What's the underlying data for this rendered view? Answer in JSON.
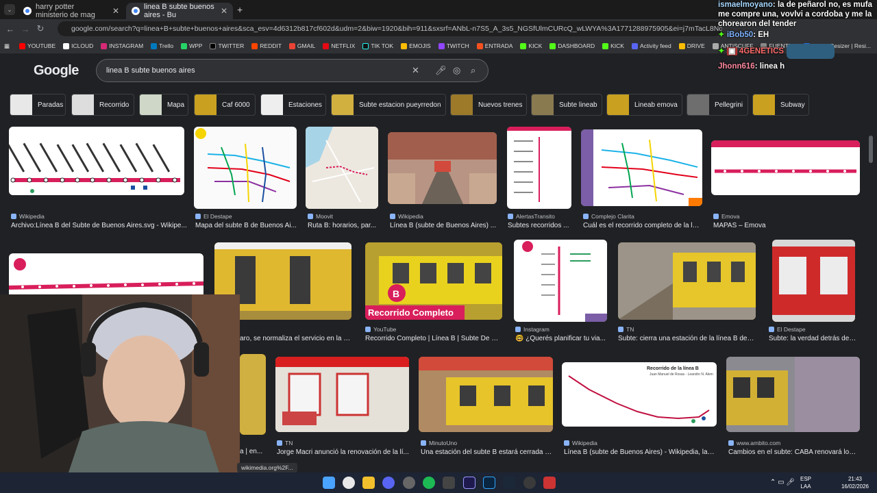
{
  "tabs": [
    {
      "title": "harry potter ministerio de mag"
    },
    {
      "title": "linea B subte buenos aires - Bu"
    }
  ],
  "url": "google.com/search?q=linea+B+subte+buenos+aires&sca_esv=4d6312b817cf602d&udm=2&biw=1920&bih=911&sxsrf=ANbL-n7S5_A_3s5_NGSfUlmCURcQ_wLWYA%3A1771288975905&ei=j7mTacL8NqeZ1sQP49TBgQ8&ved=0ah",
  "bookmarks": [
    "YOUTUBE",
    "ICLOUD",
    "INSTAGRAM",
    "Trello",
    "WPP",
    "TWITTER",
    "REDDIT",
    "GMAIL",
    "NETFLIX",
    "TIK TOK",
    "EMOJIS",
    "TWITCH",
    "ENTRADA",
    "KICK",
    "DASHBOARD",
    "KICK",
    "Activity feed",
    "DRIVE",
    "ANTISCUFF",
    "FUENTES",
    "Image Resizer | Resi..."
  ],
  "logo": "Google",
  "query": "linea B subte buenos aires",
  "chips": [
    "Paradas",
    "Recorrido",
    "Mapa",
    "Caf 6000",
    "Estaciones",
    "Subte estacion pueyrredon",
    "Nuevos trenes",
    "Subte lineab",
    "Lineab emova",
    "Pellegrini",
    "Subway"
  ],
  "row1": [
    {
      "src": "Wikipedia",
      "cap": "Archivo:Línea B del Subte de Buenos Aires.svg - Wikipe..."
    },
    {
      "src": "El Destape",
      "cap": "Mapa del subte B de Buenos Ai..."
    },
    {
      "src": "Moovit",
      "cap": "Ruta B: horarios, par..."
    },
    {
      "src": "Wikipedia",
      "cap": "Línea B (subte de Buenos Aires) ..."
    },
    {
      "src": "AlertasTransito",
      "cap": "Subtes recorridos ..."
    },
    {
      "src": "Complejo Clarita",
      "cap": "Cuál es el recorrido completo de la lí..."
    },
    {
      "src": "Emova",
      "cap": "MAPAS – Emova"
    }
  ],
  "row2": [
    {
      "src": "",
      "cap": "aro, se normaliza el servicio en la lí..."
    },
    {
      "src": "YouTube",
      "cap": "Recorrido Completo | Línea B | Subte De Bu..."
    },
    {
      "src": "Instagram",
      "cap": "🤓 ¿Querés planificar tu via..."
    },
    {
      "src": "TN",
      "cap": "Subte: cierra una estación de la línea B des..."
    },
    {
      "src": "El Destape",
      "cap": "Subte: la verdad detrás de l..."
    }
  ],
  "row3": [
    {
      "src": "TN",
      "cap": "Jorge Macri anunció la renovación de la lí..."
    },
    {
      "src": "MinutoUno",
      "cap": "Una estación del subte B estará cerrada p..."
    },
    {
      "src": "Wikipedia",
      "cap": "Línea B (subte de Buenos Aires) - Wikipedia, la e..."
    },
    {
      "src": "www.ambito.com",
      "cap": "Cambios en el subte: CABA renovará los ..."
    }
  ],
  "row3_partial": "a | en...",
  "yt_overlay": "Recorrido Completo",
  "map_title": "Recorrido de la línea B",
  "map_sub": "Juan Manuel de Rosas - Leandro N. Alem",
  "chat": [
    {
      "user": "ismaelmoyano",
      "msg": "la de peñarol no, es mufa me compre una, vovlvi a cordoba y me la chorearon del tender"
    },
    {
      "user": "iBob50",
      "msg": "EH"
    },
    {
      "user": "4GENETICS",
      "msg": ""
    },
    {
      "user": "Jhonn616",
      "msg": "linea h"
    }
  ],
  "tooltip": "wikimedia.org%2F...",
  "tray": {
    "lang": "ESP",
    "layout": "LAA",
    "time": "21:43",
    "date": "16/02/2026"
  }
}
